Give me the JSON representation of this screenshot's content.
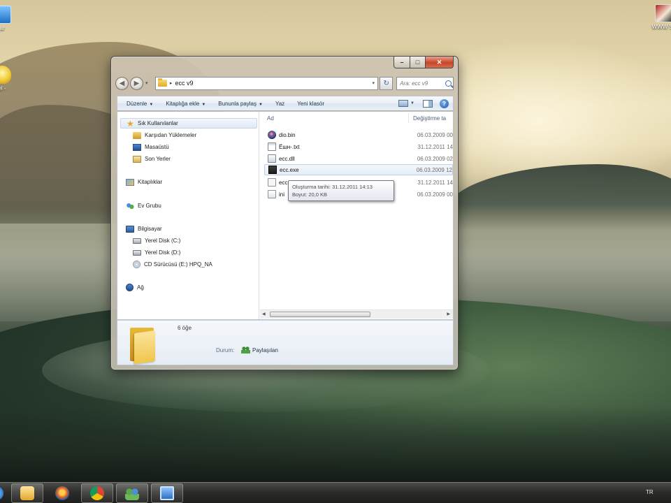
{
  "desktop": {
    "icons": [
      {
        "name": "desktop-icon-left-1",
        "label": "ar"
      },
      {
        "name": "desktop-icon-left-2",
        "label": "el -"
      },
      {
        "name": "desktop-icon-right-1",
        "label": "WWW Sa"
      }
    ]
  },
  "window": {
    "caption_buttons": {
      "minimize": "–",
      "maximize": "□",
      "close": "✕"
    },
    "address": {
      "path": "ecc v9",
      "separator": "▸"
    },
    "search": {
      "placeholder": "Ara: ecc v9"
    },
    "toolbar": {
      "items": [
        "Düzenle",
        "Kitaplığa ekle",
        "Bununla paylaş",
        "Yaz",
        "Yeni klasör"
      ],
      "help": "?"
    },
    "nav": {
      "favorites": {
        "label": "Sık Kullanılanlar",
        "items": [
          "Karşıdan Yüklemeler",
          "Masaüstü",
          "Son Yerler"
        ]
      },
      "libraries": "Kitaplıklar",
      "homegroup": "Ev Grubu",
      "computer": {
        "label": "Bilgisayar",
        "items": [
          "Yerel Disk (C:)",
          "Yerel Disk (D:)",
          "CD Sürücüsü (E:) HPQ_NA"
        ]
      },
      "network": "Ağ"
    },
    "columns": {
      "name": "Ad",
      "date": "Değiştirme ta"
    },
    "files": [
      {
        "name": "dio.bin",
        "date": "06.03.2009 00"
      },
      {
        "name": "Ёшн-.txt",
        "date": "31.12.2011 14"
      },
      {
        "name": "ecc.dll",
        "date": "06.03.2009 02"
      },
      {
        "name": "ecc.exe",
        "date": "06.03.2009 12"
      },
      {
        "name": "ecc",
        "date": "31.12.2011 14"
      },
      {
        "name": "ini",
        "date": "06.03.2009 00"
      }
    ],
    "tooltip": {
      "created": "Oluşturma tarihi: 31.12.2011 14:13",
      "size": "Boyut: 20,0 KB"
    },
    "details": {
      "count": "6 öğe",
      "status_label": "Durum:",
      "status_value": "Paylaşılan"
    }
  },
  "taskbar": {
    "language": "TR",
    "buttons": [
      "start-orb",
      "media-player",
      "firefox",
      "chrome",
      "homegroup",
      "remote-desktop"
    ]
  },
  "colors": {
    "close_button": "#c8452a",
    "toolbar_text": "#1e3250",
    "folder": "#f0c64c"
  }
}
